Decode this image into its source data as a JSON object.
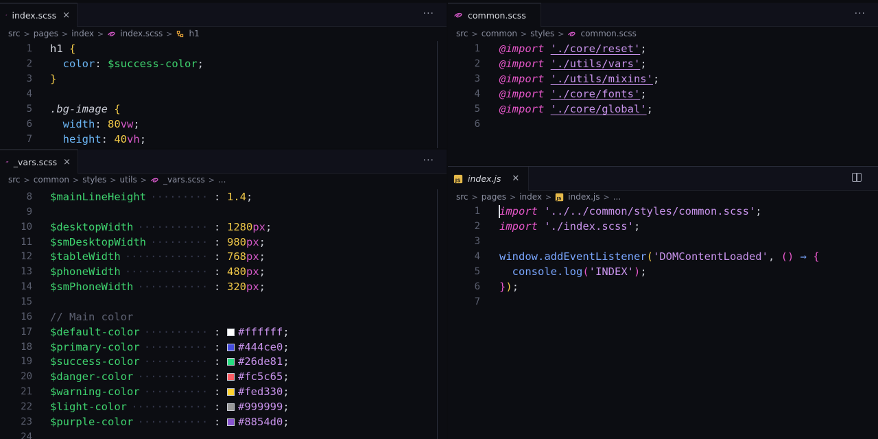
{
  "panes": {
    "top_left": {
      "tab": {
        "label": "index.scss",
        "close": "×"
      },
      "more": "···",
      "breadcrumb": [
        "src",
        "pages",
        "index",
        "index.scss",
        "h1"
      ],
      "lines": [
        {
          "n": "1",
          "parts": [
            [
              "sel",
              "h1 "
            ],
            [
              "br",
              "{"
            ]
          ]
        },
        {
          "n": "2",
          "parts": [
            [
              "punct",
              "  "
            ],
            [
              "prop",
              "color"
            ],
            [
              "punct",
              ": "
            ],
            [
              "var",
              "$success-color"
            ],
            [
              "punct",
              ";"
            ]
          ]
        },
        {
          "n": "3",
          "parts": [
            [
              "br",
              "}"
            ]
          ]
        },
        {
          "n": "4",
          "parts": []
        },
        {
          "n": "5",
          "parts": [
            [
              "cls",
              ".bg-image "
            ],
            [
              "br",
              "{"
            ]
          ]
        },
        {
          "n": "6",
          "parts": [
            [
              "punct",
              "  "
            ],
            [
              "prop",
              "width"
            ],
            [
              "punct",
              ": "
            ],
            [
              "num",
              "80"
            ],
            [
              "unit",
              "vw"
            ],
            [
              "punct",
              ";"
            ]
          ]
        },
        {
          "n": "7",
          "parts": [
            [
              "punct",
              "  "
            ],
            [
              "prop",
              "height"
            ],
            [
              "punct",
              ": "
            ],
            [
              "num",
              "40"
            ],
            [
              "unit",
              "vh"
            ],
            [
              "punct",
              ";"
            ]
          ]
        }
      ]
    },
    "bottom_left": {
      "tab": {
        "label": "_vars.scss",
        "close": "×"
      },
      "more": "···",
      "breadcrumb": [
        "src",
        "common",
        "styles",
        "utils",
        "_vars.scss",
        "..."
      ],
      "lines": [
        {
          "n": "8",
          "name": "$mainLineHeight",
          "value": [
            [
              "num",
              "1.4"
            ]
          ]
        },
        {
          "n": "9"
        },
        {
          "n": "10",
          "name": "$desktopWidth",
          "value": [
            [
              "num",
              "1280"
            ],
            [
              "unit",
              "px"
            ]
          ]
        },
        {
          "n": "11",
          "name": "$smDesktopWidth",
          "value": [
            [
              "num",
              "980"
            ],
            [
              "unit",
              "px"
            ]
          ]
        },
        {
          "n": "12",
          "name": "$tableWidth",
          "value": [
            [
              "num",
              "768"
            ],
            [
              "unit",
              "px"
            ]
          ]
        },
        {
          "n": "13",
          "name": "$phoneWidth",
          "value": [
            [
              "num",
              "480"
            ],
            [
              "unit",
              "px"
            ]
          ]
        },
        {
          "n": "14",
          "name": "$smPhoneWidth",
          "value": [
            [
              "num",
              "320"
            ],
            [
              "unit",
              "px"
            ]
          ]
        },
        {
          "n": "15"
        },
        {
          "n": "16",
          "comment": "// Main color"
        },
        {
          "n": "17",
          "name": "$default-color",
          "hex": "#ffffff",
          "swatch": "#ffffff"
        },
        {
          "n": "18",
          "name": "$primary-color",
          "hex": "#444ce0",
          "swatch": "#444ce0"
        },
        {
          "n": "19",
          "name": "$success-color",
          "hex": "#26de81",
          "swatch": "#26de81"
        },
        {
          "n": "20",
          "name": "$danger-color",
          "hex": "#fc5c65",
          "swatch": "#fc5c65"
        },
        {
          "n": "21",
          "name": "$warning-color",
          "hex": "#fed330",
          "swatch": "#fed330"
        },
        {
          "n": "22",
          "name": "$light-color",
          "hex": "#999999",
          "swatch": "#999999"
        },
        {
          "n": "23",
          "name": "$purple-color",
          "hex": "#8854d0",
          "swatch": "#8854d0"
        },
        {
          "n": "24"
        }
      ]
    },
    "top_right": {
      "tab": {
        "label": "common.scss",
        "close": ""
      },
      "more": "···",
      "breadcrumb": [
        "src",
        "common",
        "styles",
        "common.scss"
      ],
      "lines": [
        {
          "n": "1",
          "parts": [
            [
              "at",
              "@import "
            ],
            [
              "str",
              "'./core/reset'"
            ],
            [
              "punct",
              ";"
            ]
          ]
        },
        {
          "n": "2",
          "parts": [
            [
              "at",
              "@import "
            ],
            [
              "str",
              "'./utils/vars'"
            ],
            [
              "punct",
              ";"
            ]
          ]
        },
        {
          "n": "3",
          "parts": [
            [
              "at",
              "@import "
            ],
            [
              "str",
              "'./utils/mixins'"
            ],
            [
              "punct",
              ";"
            ]
          ]
        },
        {
          "n": "4",
          "parts": [
            [
              "at",
              "@import "
            ],
            [
              "str",
              "'./core/fonts'"
            ],
            [
              "punct",
              ";"
            ]
          ]
        },
        {
          "n": "5",
          "parts": [
            [
              "at",
              "@import "
            ],
            [
              "str",
              "'./core/global'"
            ],
            [
              "punct",
              ";"
            ]
          ]
        },
        {
          "n": "6",
          "parts": []
        }
      ]
    },
    "bottom_right": {
      "tab": {
        "label": "index.js",
        "close": "✕"
      },
      "breadcrumb": [
        "src",
        "pages",
        "index",
        "index.js",
        "..."
      ],
      "lines": [
        {
          "n": "1",
          "parts": [
            [
              "at",
              "import "
            ],
            [
              "str2",
              "'../../common/styles/common.scss'"
            ],
            [
              "punct",
              ";"
            ]
          ]
        },
        {
          "n": "2",
          "parts": [
            [
              "at",
              "import "
            ],
            [
              "str2",
              "'./index.scss'"
            ],
            [
              "punct",
              ";"
            ]
          ]
        },
        {
          "n": "3",
          "parts": []
        },
        {
          "n": "4",
          "parts": [
            [
              "id",
              "window.addEventListener"
            ],
            [
              "br",
              "("
            ],
            [
              "str2",
              "'DOMContentLoaded'"
            ],
            [
              "punct",
              ", "
            ],
            [
              "par",
              "()"
            ],
            [
              "punct",
              " "
            ],
            [
              "arrow",
              "⇒"
            ],
            [
              "punct",
              " "
            ],
            [
              "par",
              "{"
            ]
          ]
        },
        {
          "n": "5",
          "parts": [
            [
              "punct",
              "  "
            ],
            [
              "id",
              "console.log"
            ],
            [
              "par",
              "("
            ],
            [
              "str2",
              "'INDEX'"
            ],
            [
              "par",
              ")"
            ],
            [
              "punct",
              ";"
            ]
          ]
        },
        {
          "n": "6",
          "parts": [
            [
              "par",
              "}"
            ],
            [
              "br",
              ")"
            ],
            [
              "punct",
              ";"
            ]
          ]
        },
        {
          "n": "7",
          "parts": []
        }
      ]
    }
  },
  "colors": {
    "background": "#0c0d12",
    "tabbar": "#10111a",
    "scss_icon": "#d659c9",
    "js_icon": "#e5b94a"
  }
}
